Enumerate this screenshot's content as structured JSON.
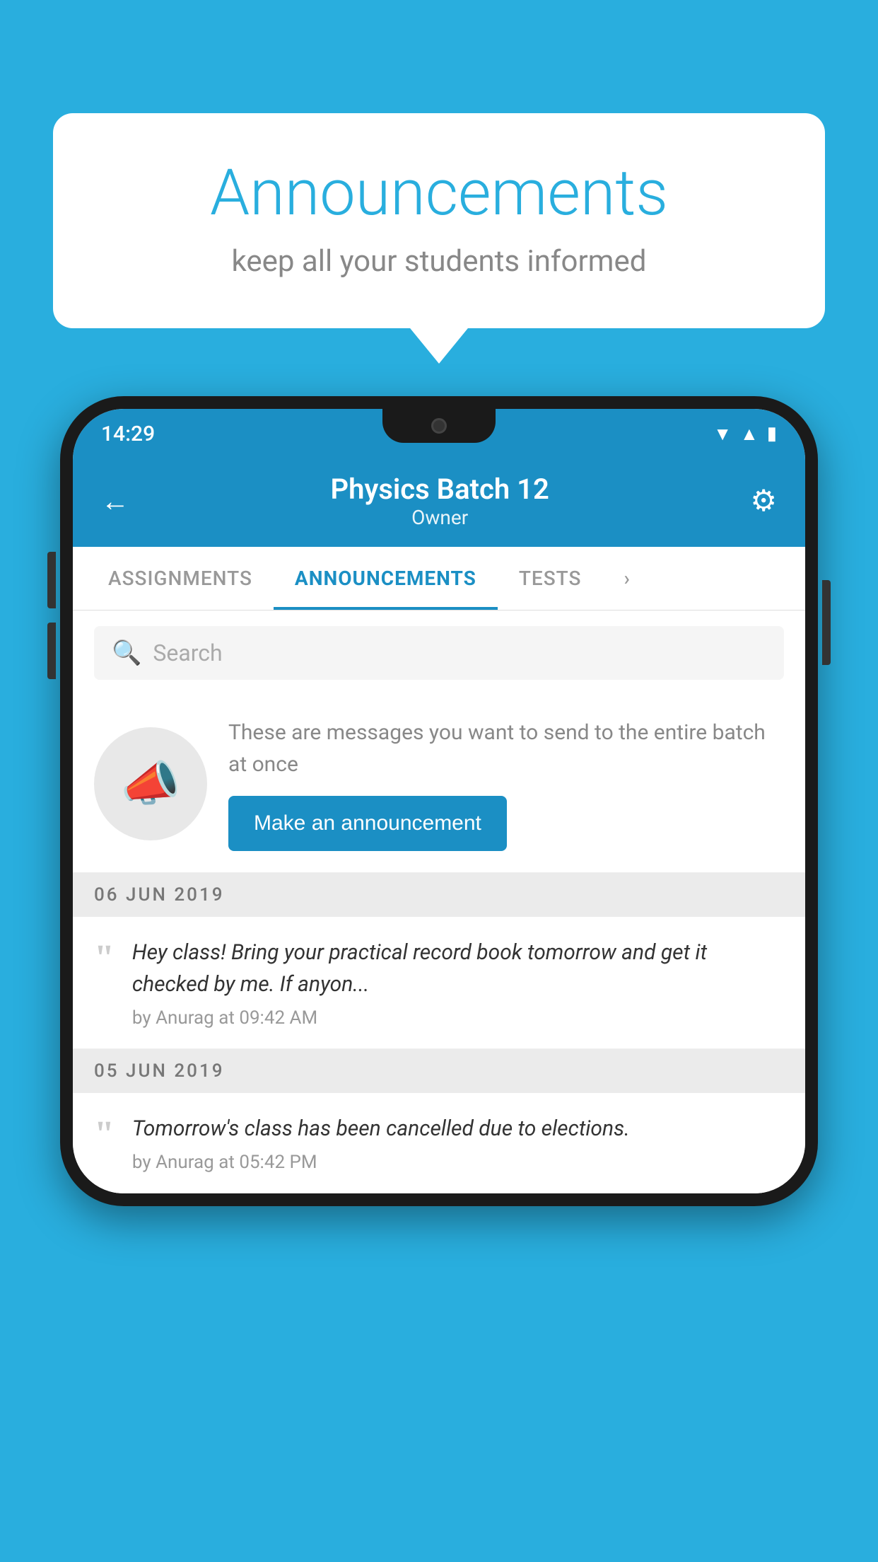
{
  "bubble": {
    "title": "Announcements",
    "subtitle": "keep all your students informed"
  },
  "phone": {
    "status": {
      "time": "14:29",
      "icons": [
        "▲",
        "▲",
        "▮"
      ]
    },
    "header": {
      "title": "Physics Batch 12",
      "subtitle": "Owner",
      "back_label": "←",
      "gear_label": "⚙"
    },
    "tabs": [
      {
        "label": "ASSIGNMENTS",
        "active": false
      },
      {
        "label": "ANNOUNCEMENTS",
        "active": true
      },
      {
        "label": "TESTS",
        "active": false
      },
      {
        "label": "⋯",
        "active": false
      }
    ],
    "search": {
      "placeholder": "Search"
    },
    "announcement_section": {
      "description": "These are messages you want to send to the entire batch at once",
      "button_label": "Make an announcement"
    },
    "messages": [
      {
        "date": "06  JUN  2019",
        "text": "Hey class! Bring your practical record book tomorrow and get it checked by me. If anyon...",
        "meta": "by Anurag at 09:42 AM"
      },
      {
        "date": "05  JUN  2019",
        "text": "Tomorrow's class has been cancelled due to elections.",
        "meta": "by Anurag at 05:42 PM"
      }
    ]
  }
}
